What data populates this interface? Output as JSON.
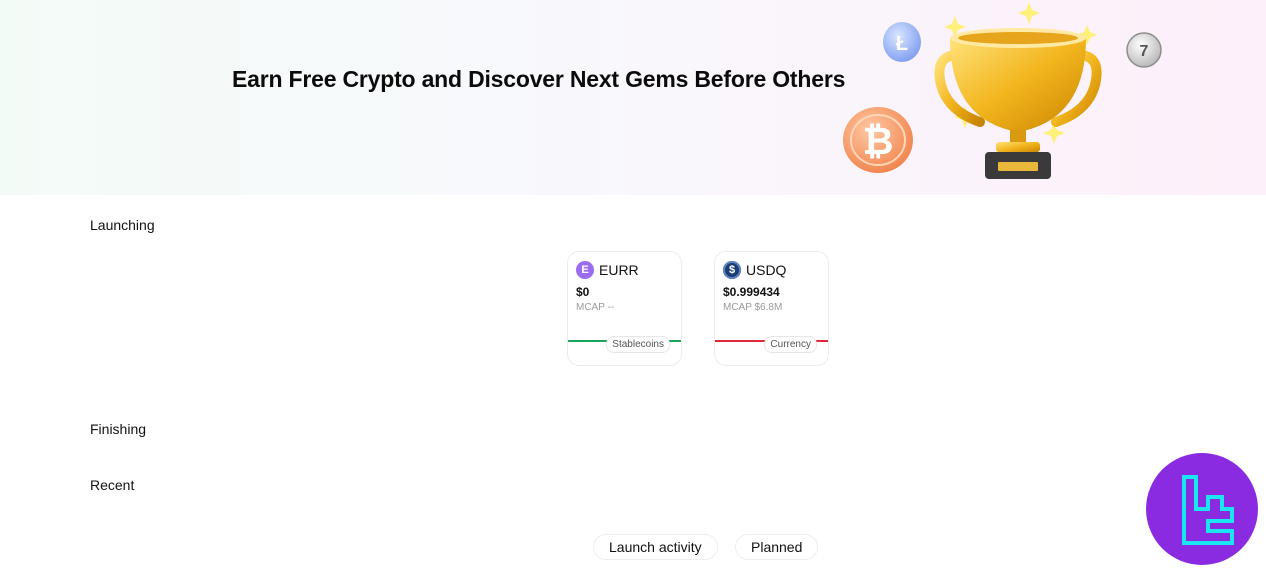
{
  "banner": {
    "title": "Earn Free Crypto and Discover Next Gems Before Others"
  },
  "sections": {
    "launching": "Launching",
    "finishing": "Finishing",
    "recent": "Recent"
  },
  "cards": [
    {
      "symbol": "EURR",
      "icon": "eurr-coin-icon",
      "icon_glyph": "E",
      "icon_color": "#9b6bf2",
      "price": "$0",
      "mcap": "MCAP --",
      "tag": "Stablecoins",
      "trend_color": "#1aa35c"
    },
    {
      "symbol": "USDQ",
      "icon": "usdq-coin-icon",
      "icon_glyph": "$",
      "icon_color": "#1b3f73",
      "price": "$0.999434",
      "mcap": "MCAP $6.8M",
      "tag": "Currency",
      "trend_color": "#e0283b"
    }
  ],
  "tabs": {
    "launch_activity": "Launch activity",
    "planned": "Planned"
  },
  "colors": {
    "badge_bg": "#8a2be2",
    "badge_glyph": "#19e6f0"
  }
}
